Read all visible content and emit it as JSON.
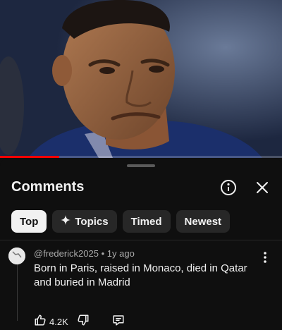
{
  "video": {
    "thumbnail_alt": "",
    "progress_fraction": 0.21,
    "progress_color": "#ff0000"
  },
  "panel": {
    "title": "Comments",
    "info_icon": "info-circle-icon",
    "close_icon": "close-icon"
  },
  "filters": [
    {
      "label": "Top",
      "active": true
    },
    {
      "label": "Topics",
      "icon": "sparkle-icon",
      "active": false
    },
    {
      "label": "Timed",
      "active": false
    },
    {
      "label": "Newest",
      "active": false
    }
  ],
  "comment": {
    "author": "@frederick2025",
    "separator": "•",
    "age": "1y ago",
    "text": "Born in Paris, raised in Monaco, died in Qatar and buried in Madrid",
    "like_count": "4.2K",
    "icons": [
      "thumbs-up-icon",
      "thumbs-down-icon",
      "reply-icon",
      "more-vertical-icon"
    ]
  }
}
